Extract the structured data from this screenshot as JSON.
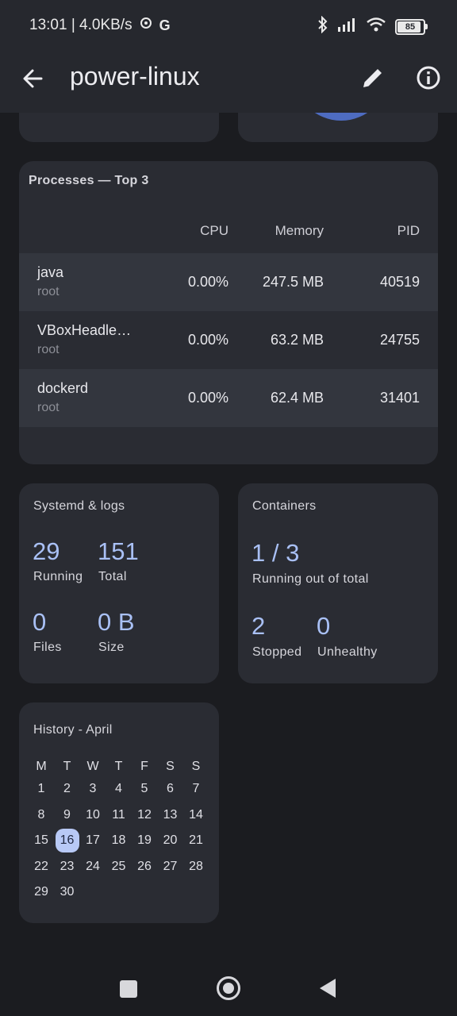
{
  "status_bar": {
    "time_speed": "13:01 | 4.0KB/s",
    "g_label": "G",
    "battery": "85"
  },
  "app_bar": {
    "title": "power-linux"
  },
  "processes": {
    "title": "Processes — Top 3",
    "headers": {
      "cpu": "CPU",
      "memory": "Memory",
      "pid": "PID"
    },
    "rows": [
      {
        "name": "java",
        "user": "root",
        "cpu": "0.00%",
        "memory": "247.5 MB",
        "pid": "40519"
      },
      {
        "name": "VBoxHeadle…",
        "user": "root",
        "cpu": "0.00%",
        "memory": "63.2 MB",
        "pid": "24755"
      },
      {
        "name": "dockerd",
        "user": "root",
        "cpu": "0.00%",
        "memory": "62.4 MB",
        "pid": "31401"
      }
    ]
  },
  "systemd": {
    "title": "Systemd & logs",
    "running_num": "29",
    "running_lbl": "Running",
    "total_num": "151",
    "total_lbl": "Total",
    "files_num": "0",
    "files_lbl": "Files",
    "size_num": "0 B",
    "size_lbl": "Size"
  },
  "containers": {
    "title": "Containers",
    "ratio": "1 / 3",
    "ratio_lbl": "Running out of total",
    "stopped_num": "2",
    "stopped_lbl": "Stopped",
    "unhealthy_num": "0",
    "unhealthy_lbl": "Unhealthy"
  },
  "history": {
    "title": "History - April",
    "weekdays": [
      "M",
      "T",
      "W",
      "T",
      "F",
      "S",
      "S"
    ],
    "days": [
      "1",
      "2",
      "3",
      "4",
      "5",
      "6",
      "7",
      "8",
      "9",
      "10",
      "11",
      "12",
      "13",
      "14",
      "15",
      "16",
      "17",
      "18",
      "19",
      "20",
      "21",
      "22",
      "23",
      "24",
      "25",
      "26",
      "27",
      "28",
      "29",
      "30"
    ],
    "selected": "16"
  },
  "colors": {
    "accent": "#a9c0f5",
    "selected_day_bg": "#b8c9f6",
    "card": "#2a2c33",
    "background": "#1b1c20"
  }
}
